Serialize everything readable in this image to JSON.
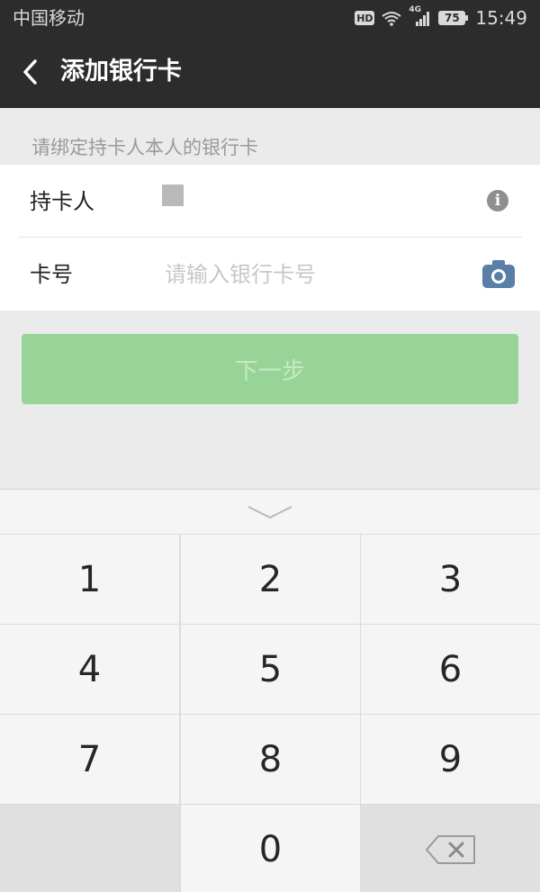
{
  "status_bar": {
    "carrier": "中国移动",
    "hd_badge": "HD",
    "network": "4G",
    "battery": "75",
    "time": "15:49"
  },
  "header": {
    "title": "添加银行卡",
    "back_icon": "chevron-left-icon"
  },
  "form": {
    "hint": "请绑定持卡人本人的银行卡",
    "holder_label": "持卡人",
    "holder_info_icon": "info-icon",
    "card_label": "卡号",
    "card_placeholder": "请输入银行卡号",
    "card_value": "",
    "camera_icon": "camera-icon"
  },
  "next_button": {
    "label": "下一步"
  },
  "keyboard": {
    "collapse_icon": "chevron-down-icon",
    "keys": [
      "1",
      "2",
      "3",
      "4",
      "5",
      "6",
      "7",
      "8",
      "9",
      "",
      "0",
      "delete"
    ],
    "delete_icon": "backspace-icon"
  },
  "colors": {
    "header_bg": "#2c2c2c",
    "primary_disabled": "#98d498",
    "page_bg": "#ebebeb",
    "camera_blue": "#5a7fa6"
  }
}
